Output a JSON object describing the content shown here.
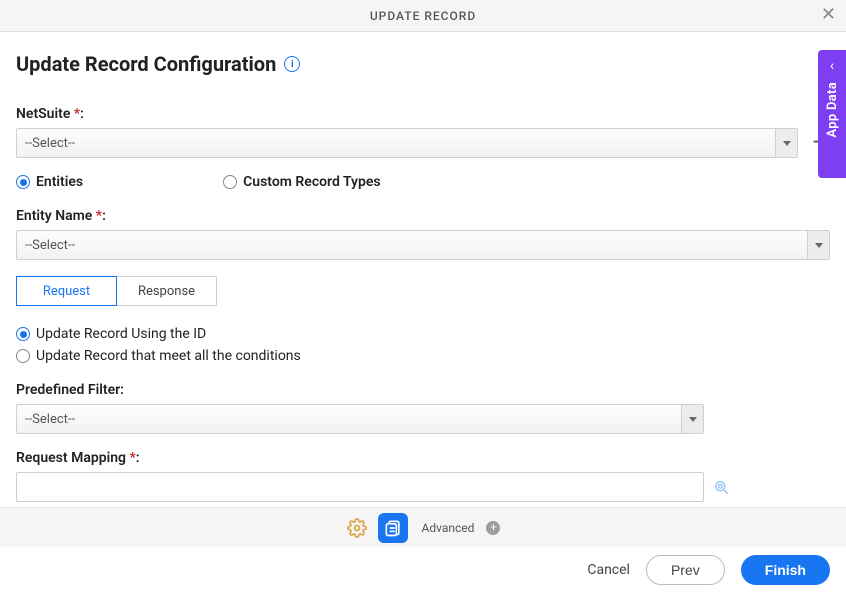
{
  "header": {
    "title": "UPDATE RECORD"
  },
  "page": {
    "title": "Update Record Configuration"
  },
  "fields": {
    "netsuite": {
      "label": "NetSuite",
      "required": "*",
      "colon": ":",
      "value": "--Select--"
    },
    "recordType": {
      "entities": "Entities",
      "custom": "Custom Record Types",
      "selected": "entities"
    },
    "entityName": {
      "label": "Entity Name",
      "required": "*",
      "colon": ":",
      "value": "--Select--"
    },
    "tabs": {
      "request": "Request",
      "response": "Response",
      "active": "request"
    },
    "updateMode": {
      "byId": "Update Record Using the ID",
      "byConditions": "Update Record that meet all the conditions",
      "selected": "byId"
    },
    "predefinedFilter": {
      "label": "Predefined Filter:",
      "value": "--Select--"
    },
    "requestMapping": {
      "label": "Request Mapping",
      "required": "*",
      "colon": ":",
      "value": ""
    }
  },
  "footer": {
    "advanced": "Advanced",
    "cancel": "Cancel",
    "prev": "Prev",
    "finish": "Finish"
  },
  "side": {
    "label": "App Data"
  }
}
